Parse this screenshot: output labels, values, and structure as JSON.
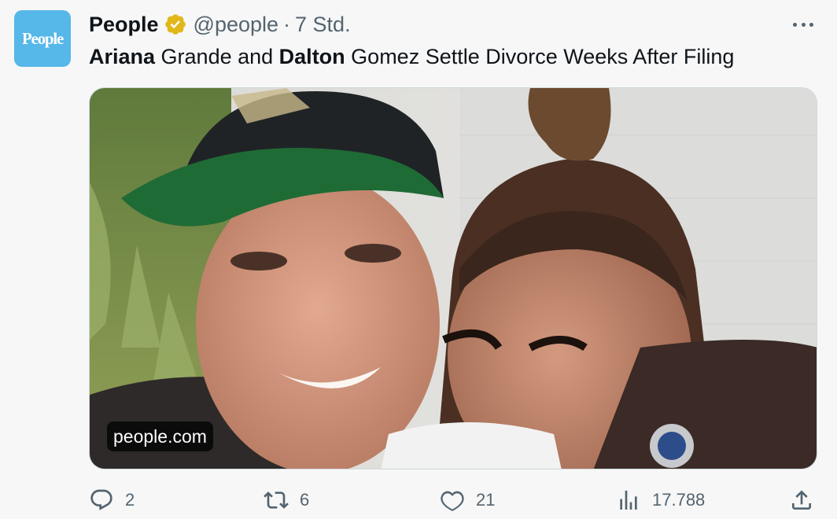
{
  "author": {
    "avatar_text": "People",
    "name": "People",
    "verified_icon": "verified-badge-gold",
    "handle": "@people",
    "separator": "·",
    "timestamp": "7 Std."
  },
  "tweet": {
    "text_parts": {
      "p1": "Ariana",
      "p2": " Grande and ",
      "p3": "Dalton",
      "p4": " Gomez Settle Divorce Weeks After Filing"
    }
  },
  "media": {
    "domain": "people.com"
  },
  "actions": {
    "reply_count": "2",
    "retweet_count": "6",
    "like_count": "21",
    "views_count": "17.788"
  },
  "icons": {
    "more": "more-horizontal-icon",
    "reply": "reply-icon",
    "retweet": "retweet-icon",
    "like": "heart-icon",
    "views": "views-chart-icon",
    "share": "share-icon"
  },
  "colors": {
    "avatar_bg": "#56b7e9",
    "verified_gold": "#e2b719",
    "muted_text": "#536471"
  }
}
